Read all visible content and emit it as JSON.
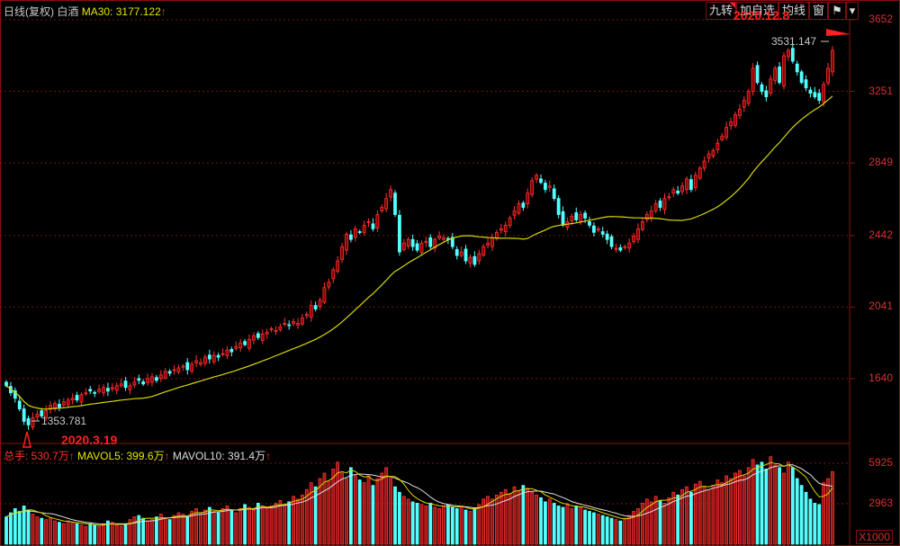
{
  "header": {
    "period": "日线(复权)",
    "name": "白酒",
    "ma_label": "MA30: 3177.122",
    "arrow": "↑"
  },
  "toolbar": {
    "buttons": [
      "九转",
      "加自选",
      "均线",
      "窗"
    ],
    "icon": "flag-icon",
    "dropdown": "▾"
  },
  "annotations": {
    "low_value": "1353.781",
    "low_date": "2020.3.19",
    "high_value": "3531.147",
    "high_date": "2020.12.8"
  },
  "volume_header": {
    "total": "总手: 530.7万",
    "mavol5": "MAVOL5: 399.6万",
    "mavol10": "MAVOL10: 391.4万",
    "arrow": "↑"
  },
  "colors": {
    "up": "#ff3232",
    "down": "#54ffff",
    "ma": "#d8d800",
    "mavol10": "#e0e0e0",
    "axis": "#d83030"
  },
  "chart_data": {
    "type": "candlestick",
    "title": "日线(复权) 白酒",
    "price_ticks": [
      "3652",
      "3251",
      "2849",
      "2442",
      "2041",
      "1640"
    ],
    "price_ylim": [
      1330,
      3652
    ],
    "volume_ticks": [
      "5925",
      "2963"
    ],
    "volume_unit": "X1000",
    "close": [
      1600,
      1560,
      1530,
      1470,
      1400,
      1380,
      1420,
      1440,
      1430,
      1460,
      1490,
      1500,
      1480,
      1510,
      1520,
      1530,
      1520,
      1550,
      1560,
      1570,
      1560,
      1580,
      1590,
      1570,
      1590,
      1600,
      1610,
      1590,
      1600,
      1620,
      1630,
      1610,
      1640,
      1650,
      1630,
      1660,
      1680,
      1670,
      1690,
      1700,
      1710,
      1690,
      1720,
      1740,
      1730,
      1760,
      1750,
      1770,
      1760,
      1780,
      1800,
      1790,
      1820,
      1840,
      1830,
      1860,
      1880,
      1870,
      1890,
      1900,
      1920,
      1910,
      1930,
      1950,
      1940,
      1960,
      1950,
      1980,
      2000,
      2050,
      2030,
      2080,
      2150,
      2180,
      2250,
      2300,
      2380,
      2450,
      2420,
      2480,
      2460,
      2500,
      2520,
      2480,
      2560,
      2600,
      2650,
      2700,
      2560,
      2350,
      2400,
      2420,
      2380,
      2360,
      2400,
      2410,
      2380,
      2420,
      2440,
      2430,
      2420,
      2380,
      2330,
      2350,
      2300,
      2320,
      2280,
      2340,
      2380,
      2400,
      2430,
      2460,
      2480,
      2500,
      2540,
      2580,
      2620,
      2600,
      2680,
      2750,
      2780,
      2740,
      2700,
      2720,
      2650,
      2560,
      2500,
      2520,
      2550,
      2530,
      2560,
      2540,
      2500,
      2460,
      2480,
      2450,
      2420,
      2380,
      2370,
      2360,
      2380,
      2400,
      2440,
      2480,
      2520,
      2560,
      2580,
      2620,
      2600,
      2650,
      2660,
      2700,
      2680,
      2720,
      2760,
      2700,
      2780,
      2820,
      2860,
      2900,
      2920,
      2960,
      3000,
      3050,
      3080,
      3120,
      3150,
      3200,
      3250,
      3380,
      3300,
      3250,
      3220,
      3320,
      3380,
      3300,
      3450,
      3480,
      3420,
      3360,
      3300,
      3270,
      3240,
      3220,
      3200,
      3290,
      3380,
      3480
    ],
    "volume_wan": [
      200,
      230,
      260,
      240,
      280,
      250,
      220,
      200,
      190,
      180,
      190,
      170,
      160,
      150,
      170,
      160,
      150,
      140,
      130,
      150,
      140,
      130,
      150,
      170,
      160,
      140,
      130,
      150,
      180,
      200,
      210,
      190,
      170,
      180,
      200,
      220,
      190,
      180,
      210,
      230,
      220,
      200,
      240,
      260,
      230,
      250,
      270,
      240,
      230,
      260,
      280,
      250,
      230,
      260,
      290,
      270,
      250,
      300,
      280,
      260,
      280,
      300,
      320,
      290,
      310,
      350,
      330,
      360,
      400,
      450,
      420,
      480,
      520,
      460,
      550,
      600,
      520,
      480,
      560,
      500,
      470,
      450,
      500,
      430,
      480,
      520,
      560,
      490,
      420,
      380,
      350,
      330,
      310,
      300,
      290,
      280,
      300,
      270,
      260,
      280,
      290,
      270,
      260,
      280,
      250,
      240,
      260,
      290,
      330,
      350,
      330,
      360,
      380,
      400,
      370,
      420,
      390,
      430,
      410,
      380,
      360,
      340,
      310,
      330,
      300,
      280,
      270,
      290,
      260,
      280,
      270,
      250,
      240,
      230,
      220,
      210,
      200,
      190,
      180,
      170,
      190,
      210,
      240,
      260,
      300,
      330,
      310,
      350,
      320,
      300,
      340,
      380,
      360,
      400,
      420,
      380,
      440,
      460,
      420,
      400,
      430,
      470,
      450,
      500,
      480,
      520,
      540,
      500,
      560,
      620,
      580,
      600,
      550,
      640,
      580,
      560,
      520,
      600,
      560,
      480,
      430,
      380,
      330,
      300,
      290,
      450,
      480,
      531
    ]
  }
}
